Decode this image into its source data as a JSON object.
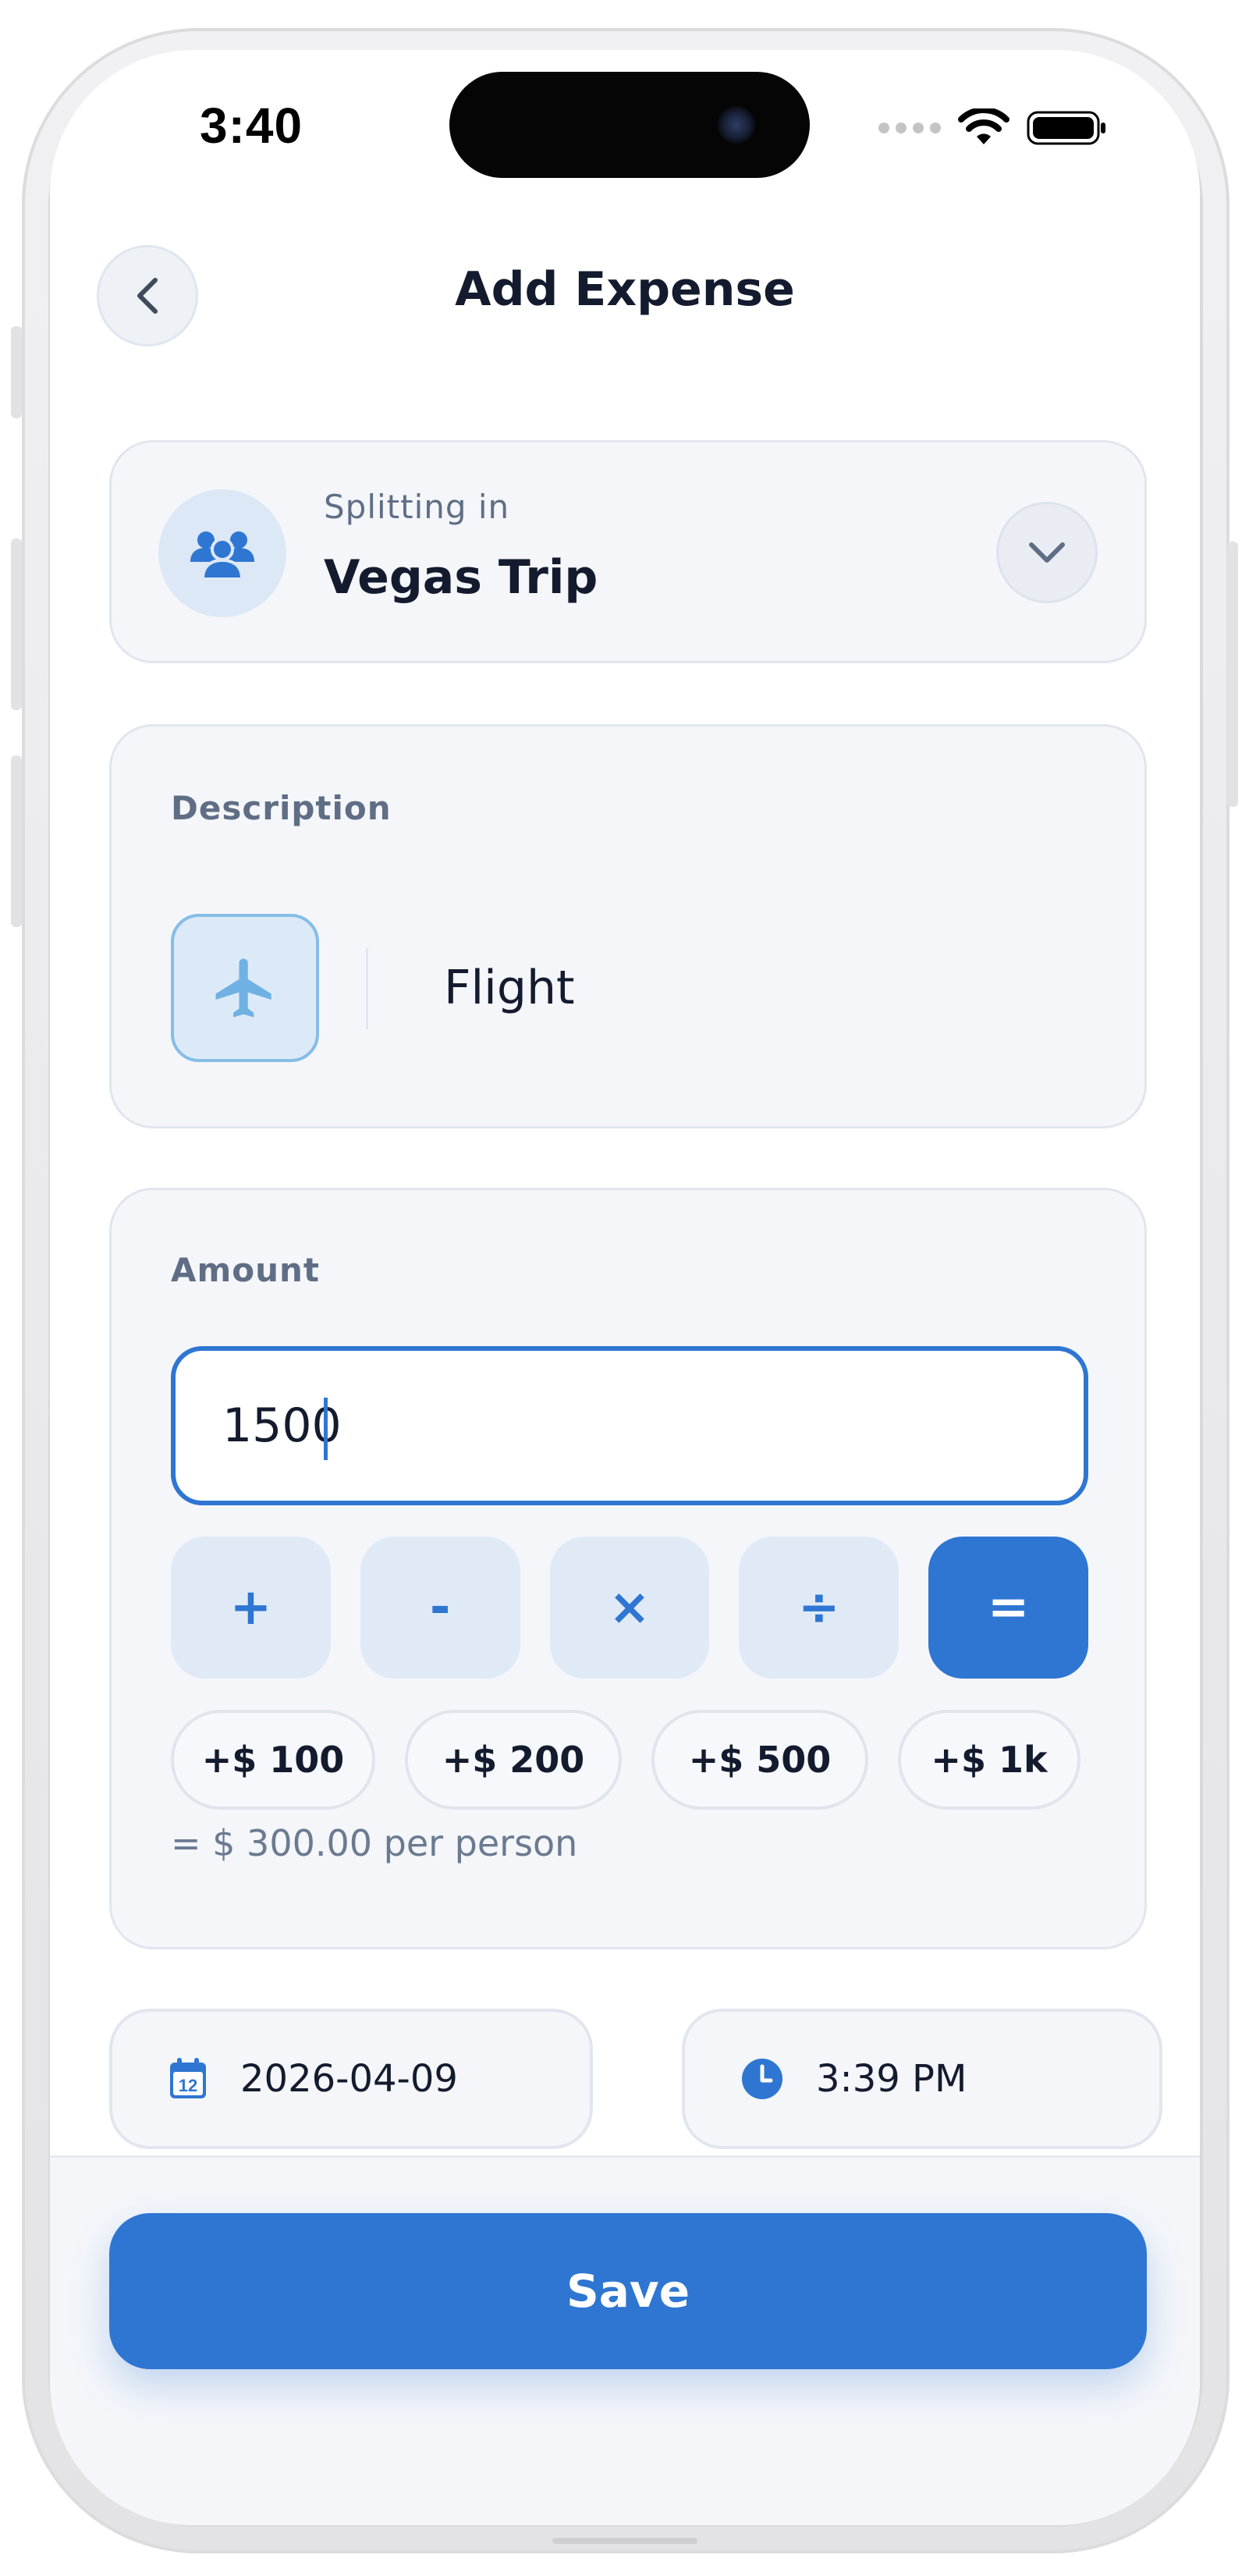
{
  "status_bar": {
    "time": "3:40"
  },
  "header": {
    "title": "Add Expense",
    "back_icon": "chevron-left-icon"
  },
  "group": {
    "sub_label": "Splitting in",
    "name": "Vegas Trip",
    "icon": "group-users-icon",
    "dropdown_icon": "chevron-down-icon"
  },
  "description": {
    "label": "Description",
    "value": "Flight",
    "category_icon": "airplane-icon"
  },
  "amount": {
    "label": "Amount",
    "value": "1500",
    "operators": [
      "+",
      "-",
      "×",
      "÷",
      "="
    ],
    "quick_adds": [
      "+$ 100",
      "+$ 200",
      "+$ 500",
      "+$ 1k"
    ],
    "per_person": "= $ 300.00 per person"
  },
  "date": {
    "value": "2026-04-09",
    "icon": "calendar-icon",
    "day_number": "12"
  },
  "time": {
    "value": "3:39 PM",
    "icon": "clock-icon"
  },
  "actions": {
    "save_label": "Save"
  },
  "colors": {
    "accent": "#2e76d2",
    "title_text": "#141b2e",
    "muted_text": "#5f6e85",
    "card_bg": "#f4f6fa",
    "airplane_icon": "#6fb1e3"
  }
}
